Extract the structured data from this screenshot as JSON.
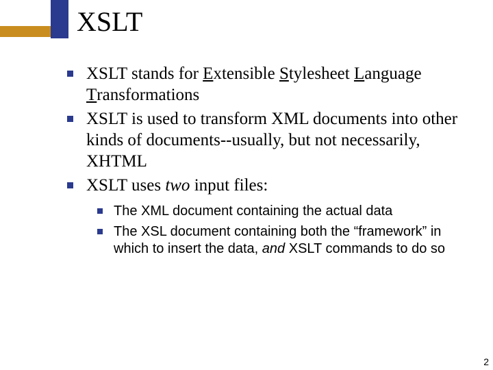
{
  "title": "XSLT",
  "bullets": [
    {
      "pre": "XSLT stands for ",
      "underline": "E",
      "mid": "xtensible ",
      "underline2": "S",
      "mid2": "tylesheet ",
      "underline3": "L",
      "mid3": "anguage ",
      "underline4": "T",
      "post": "ransformations"
    },
    {
      "text": "XSLT is used to transform XML documents into other kinds of documents--usually, but not necessarily, XHTML"
    },
    {
      "pre": "XSLT uses ",
      "ital": "two",
      "post": " input files:"
    }
  ],
  "sub_bullets": [
    {
      "text": "The XML document containing the actual data"
    },
    {
      "pre": "The XSL document containing both the “framework” in which to insert the data, ",
      "ital": "and",
      "post": " XSLT commands to do so"
    }
  ],
  "page_number": "2"
}
